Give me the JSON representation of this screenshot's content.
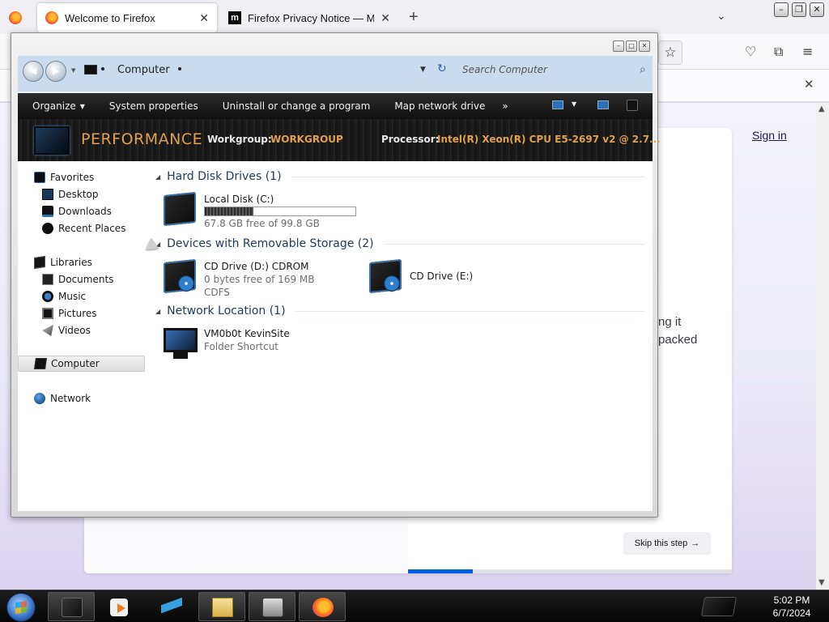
{
  "firefox": {
    "tabs": [
      {
        "title": "Welcome to Firefox",
        "close": "✕"
      },
      {
        "title": "Firefox Privacy Notice — Mozill",
        "close": "✕"
      }
    ],
    "new_tab": "+",
    "list_all_tabs": "⌄",
    "window_controls": {
      "minimize": "–",
      "restore": "❐",
      "close": "✕"
    },
    "bookmark_star": "☆",
    "toolbar_icons": {
      "pocket": "♡",
      "extensions": "⧉",
      "menu": "≡"
    },
    "notification_close": "✕",
    "page": {
      "sign_in": "Sign in",
      "partial_line_1": "ng it",
      "partial_line_2": "packed",
      "skip_step": "Skip this step",
      "skip_arrow": "→",
      "onboarding_progress": 0.2
    }
  },
  "explorer": {
    "window_controls": {
      "minimize": "–",
      "maximize": "□",
      "close": "✕"
    },
    "nav": {
      "back": "◀",
      "forward": "▶",
      "recent_dropdown": "▼"
    },
    "address": {
      "location": "Computer",
      "dropdown": "▼",
      "refresh": "↻"
    },
    "search": {
      "placeholder": "Search Computer",
      "icon": "⌕"
    },
    "toolbar": {
      "organize": "Organize",
      "organize_arrow": "▼",
      "system_properties": "System properties",
      "uninstall": "Uninstall or change a program",
      "map_network": "Map network drive",
      "more": "»",
      "view_dropdown": "▼"
    },
    "banner": {
      "title": "PERFORMANCE",
      "workgroup_label": "Workgroup:",
      "workgroup_value": "WORKGROUP",
      "processor_label": "Processor:",
      "processor_value": "Intel(R) Xeon(R) CPU E5-2697 v2 @ 2.7..."
    },
    "navigation_pane": {
      "favorites": "Favorites",
      "desktop": "Desktop",
      "downloads": "Downloads",
      "recent_places": "Recent Places",
      "libraries": "Libraries",
      "documents": "Documents",
      "music": "Music",
      "pictures": "Pictures",
      "videos": "Videos",
      "computer": "Computer",
      "network": "Network"
    },
    "groups": {
      "hard_disk": {
        "title": "Hard Disk Drives (1)",
        "collapse": "◢",
        "drive": {
          "name": "Local Disk (C:)",
          "free_text": "67.8 GB free of 99.8 GB",
          "used_fraction": 0.32
        }
      },
      "removable": {
        "title": "Devices with Removable Storage (2)",
        "collapse": "◢",
        "drives": [
          {
            "name": "CD Drive (D:) CDROM",
            "line2": "0 bytes free of 169 MB",
            "line3": "CDFS"
          },
          {
            "name": "CD Drive (E:)"
          }
        ]
      },
      "network": {
        "title": "Network Location (1)",
        "collapse": "◢",
        "item": {
          "name": "VM0b0t KevinSite",
          "type": "Folder Shortcut"
        }
      }
    }
  },
  "taskbar": {
    "clock": {
      "time": "5:02 PM",
      "date": "6/7/2024"
    }
  }
}
